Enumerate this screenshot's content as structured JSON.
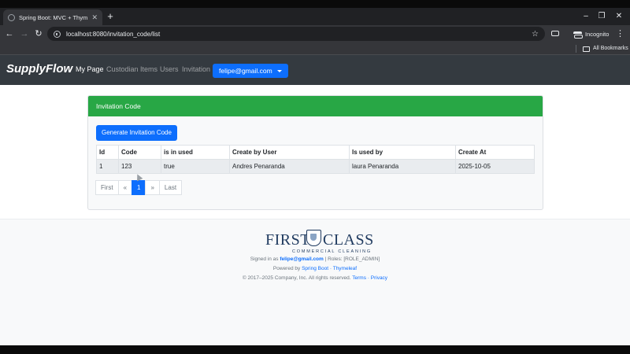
{
  "browser": {
    "tab_title": "Spring Boot: MVC + Thymeleaf",
    "new_tab_icon": "plus-icon",
    "url": "localhost:8080/invitation_code/list",
    "incognito_label": "Incognito",
    "all_bookmarks_label": "All Bookmarks"
  },
  "navbar": {
    "brand": "SupplyFlow",
    "links": [
      "My Page",
      "Custodian Items",
      "Users",
      "Invitation"
    ],
    "active_link": "My Page",
    "user_email": "felipe@gmail.com"
  },
  "card": {
    "header": "Invitation Code",
    "generate_button": "Generate Invitation Code",
    "header_color": "#28a745",
    "table": {
      "columns": [
        "Id",
        "Code",
        "is in used",
        "Create by User",
        "Is used by",
        "Create At"
      ],
      "rows": [
        [
          "1",
          "123",
          "true",
          "Andres Penaranda",
          "laura Penaranda",
          "2025-10-05"
        ]
      ]
    },
    "pagination": {
      "first": "First",
      "prev": "«",
      "current": "1",
      "next": "»",
      "last": "Last"
    }
  },
  "footer": {
    "logo": {
      "word_left": "FIRST",
      "word_right": "CLASS",
      "subtitle": "COMMERCIAL CLEANING"
    },
    "signed_in_prefix": "Signed in as",
    "signed_in_user": "felipe@gmail.com",
    "roles": "| Roles: [ROLE_ADMIN]",
    "powered_by_prefix": "Powered by",
    "powered_spring": "Spring Boot",
    "powered_sep": " · ",
    "powered_thymeleaf": "Thymeleaf",
    "copyright": "© 2017–2025 Company, Inc. All rights reserved.",
    "terms": "Terms",
    "privacy": "Privacy",
    "link_sep": " · "
  },
  "colors": {
    "primary": "#0d6efd",
    "navbar_bg": "#343a40",
    "success": "#28a745"
  }
}
